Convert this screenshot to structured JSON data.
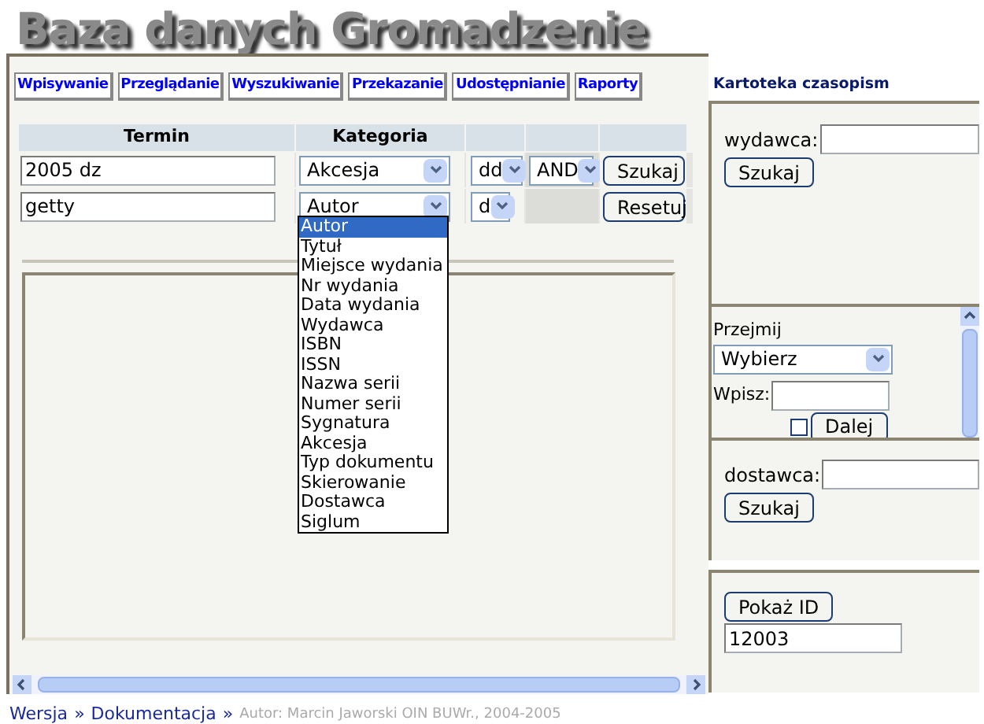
{
  "logo": "Baza danych Gromadzenie",
  "tabs": [
    "Wpisywanie",
    "Przeglądanie",
    "Wyszukiwanie",
    "Przekazanie",
    "Udostępnianie",
    "Raporty"
  ],
  "search_table": {
    "columns": [
      "Termin",
      "Kategoria"
    ],
    "rows": [
      {
        "term": "2005 dz",
        "category": "Akcesja",
        "mode": "dd",
        "operator": "AND",
        "button": "Szukaj"
      },
      {
        "term": "getty",
        "category": "Autor",
        "mode": "d",
        "button": "Resetuj"
      }
    ]
  },
  "category_dropdown": {
    "options": [
      {
        "label": "Autor",
        "selected": true
      },
      {
        "label": "Tytuł",
        "selected": false
      },
      {
        "label": "Miejsce wydania",
        "selected": false
      },
      {
        "label": "Nr wydania",
        "selected": false
      },
      {
        "label": "Data wydania",
        "selected": false
      },
      {
        "label": "Wydawca",
        "selected": false
      },
      {
        "label": "ISBN",
        "selected": false
      },
      {
        "label": "ISSN",
        "selected": false
      },
      {
        "label": "Nazwa serii",
        "selected": false
      },
      {
        "label": "Numer serii",
        "selected": false
      },
      {
        "label": "Sygnatura",
        "selected": false
      },
      {
        "label": "Akcesja",
        "selected": false
      },
      {
        "label": "Typ dokumentu",
        "selected": false
      },
      {
        "label": "Skierowanie",
        "selected": false
      },
      {
        "label": "Dostawca",
        "selected": false
      },
      {
        "label": "Siglum",
        "selected": false
      }
    ]
  },
  "sidebar": {
    "title": "Kartoteka czasopism",
    "publisher_search": {
      "label": "wydawca:",
      "button": "Szukaj"
    },
    "take_over": {
      "label": "Przejmij",
      "select": "Wybierz",
      "input_label": "Wpisz:",
      "checked": false,
      "button": "Dalej"
    },
    "supplier_search": {
      "label": "dostawca:",
      "button": "Szukaj"
    },
    "show_id": {
      "button": "Pokaż ID",
      "value": "12003"
    }
  },
  "footer": {
    "links": [
      "Wersja",
      "Dokumentacja"
    ],
    "separator": "»",
    "credit": "Autor: Marcin Jaworski OIN BUWr., 2004-2005"
  }
}
